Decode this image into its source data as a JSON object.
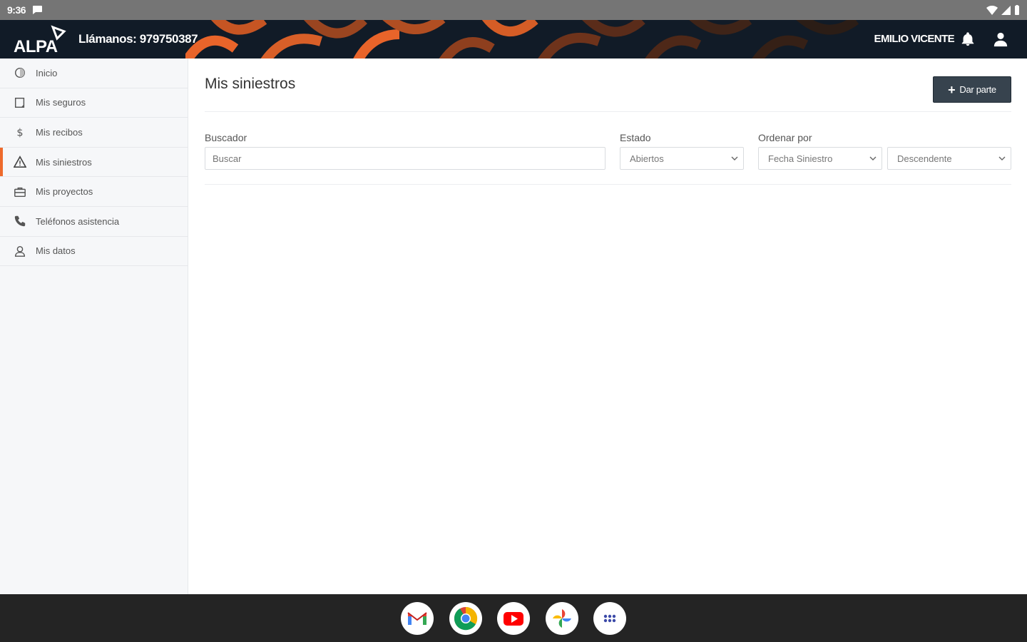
{
  "status_bar": {
    "time": "9:36"
  },
  "header": {
    "logo_text": "ALPA",
    "phone_label": "Llámanos: 979750387",
    "user_name": "EMILIO VICENTE"
  },
  "sidebar": {
    "items": [
      {
        "label": "Inicio",
        "icon": "home-icon"
      },
      {
        "label": "Mis seguros",
        "icon": "document-icon"
      },
      {
        "label": "Mis recibos",
        "icon": "dollar-icon"
      },
      {
        "label": "Mis siniestros",
        "icon": "warning-icon",
        "active": true
      },
      {
        "label": "Mis proyectos",
        "icon": "briefcase-icon"
      },
      {
        "label": "Teléfonos asistencia",
        "icon": "phone-icon"
      },
      {
        "label": "Mis datos",
        "icon": "user-icon"
      }
    ]
  },
  "main": {
    "title": "Mis siniestros",
    "dar_parte_label": "Dar parte",
    "filters": {
      "search_label": "Buscador",
      "search_placeholder": "Buscar",
      "estado_label": "Estado",
      "estado_value": "Abiertos",
      "order_label": "Ordenar por",
      "order_value": "Fecha Siniestro",
      "direction_value": "Descendente"
    }
  },
  "colors": {
    "accent": "#ee6a2c",
    "header_bg": "#111b27",
    "button_bg": "#37434e"
  },
  "taskbar": {
    "apps": [
      "gmail-icon",
      "chrome-icon",
      "youtube-icon",
      "photos-icon",
      "app-drawer-icon"
    ]
  }
}
